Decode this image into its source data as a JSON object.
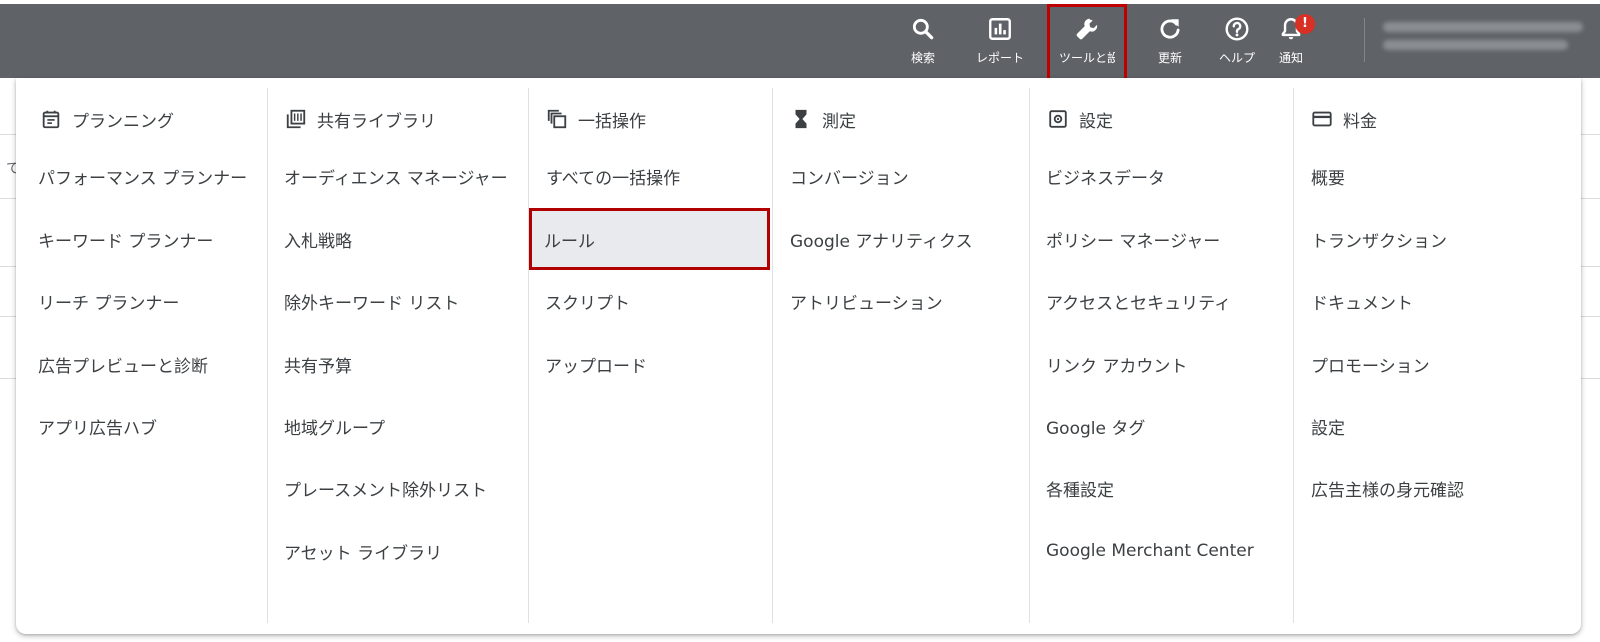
{
  "topbar": {
    "buttons": [
      {
        "label": "検索",
        "icon": "search-icon"
      },
      {
        "label": "レポート",
        "icon": "bar-chart-icon"
      },
      {
        "label": "ツールと設定",
        "icon": "wrench-icon"
      },
      {
        "label": "更新",
        "icon": "refresh-icon"
      },
      {
        "label": "ヘルプ",
        "icon": "help-icon"
      },
      {
        "label": "通知",
        "icon": "bell-icon",
        "badge": "!"
      }
    ],
    "colors": {
      "bar": "#5f6368",
      "highlight": "#c00000",
      "badge": "#d93025"
    }
  },
  "menu": {
    "columns": [
      {
        "heading": "プランニング",
        "icon": "calendar-icon",
        "items": [
          "パフォーマンス プランナー",
          "キーワード プランナー",
          "リーチ プランナー",
          "広告プレビューと診断",
          "アプリ広告ハブ"
        ]
      },
      {
        "heading": "共有ライブラリ",
        "icon": "library-icon",
        "items": [
          "オーディエンス マネージャー",
          "入札戦略",
          "除外キーワード リスト",
          "共有予算",
          "地域グループ",
          "プレースメント除外リスト",
          "アセット ライブラリ"
        ]
      },
      {
        "heading": "一括操作",
        "icon": "copy-stack-icon",
        "items": [
          "すべての一括操作",
          "ルール",
          "スクリプト",
          "アップロード"
        ],
        "selected_index": 1
      },
      {
        "heading": "測定",
        "icon": "hourglass-icon",
        "items": [
          "コンバージョン",
          "Google アナリティクス",
          "アトリビューション"
        ]
      },
      {
        "heading": "設定",
        "icon": "settings-icon",
        "items": [
          "ビジネスデータ",
          "ポリシー マネージャー",
          "アクセスとセキュリティ",
          "リンク アカウント",
          "Google タグ",
          "各種設定",
          "Google Merchant Center"
        ]
      },
      {
        "heading": "料金",
        "icon": "credit-card-icon",
        "items": [
          "概要",
          "トランザクション",
          "ドキュメント",
          "プロモーション",
          "設定",
          "広告主様の身元確認"
        ]
      }
    ]
  },
  "background": {
    "partial_text": "て"
  }
}
